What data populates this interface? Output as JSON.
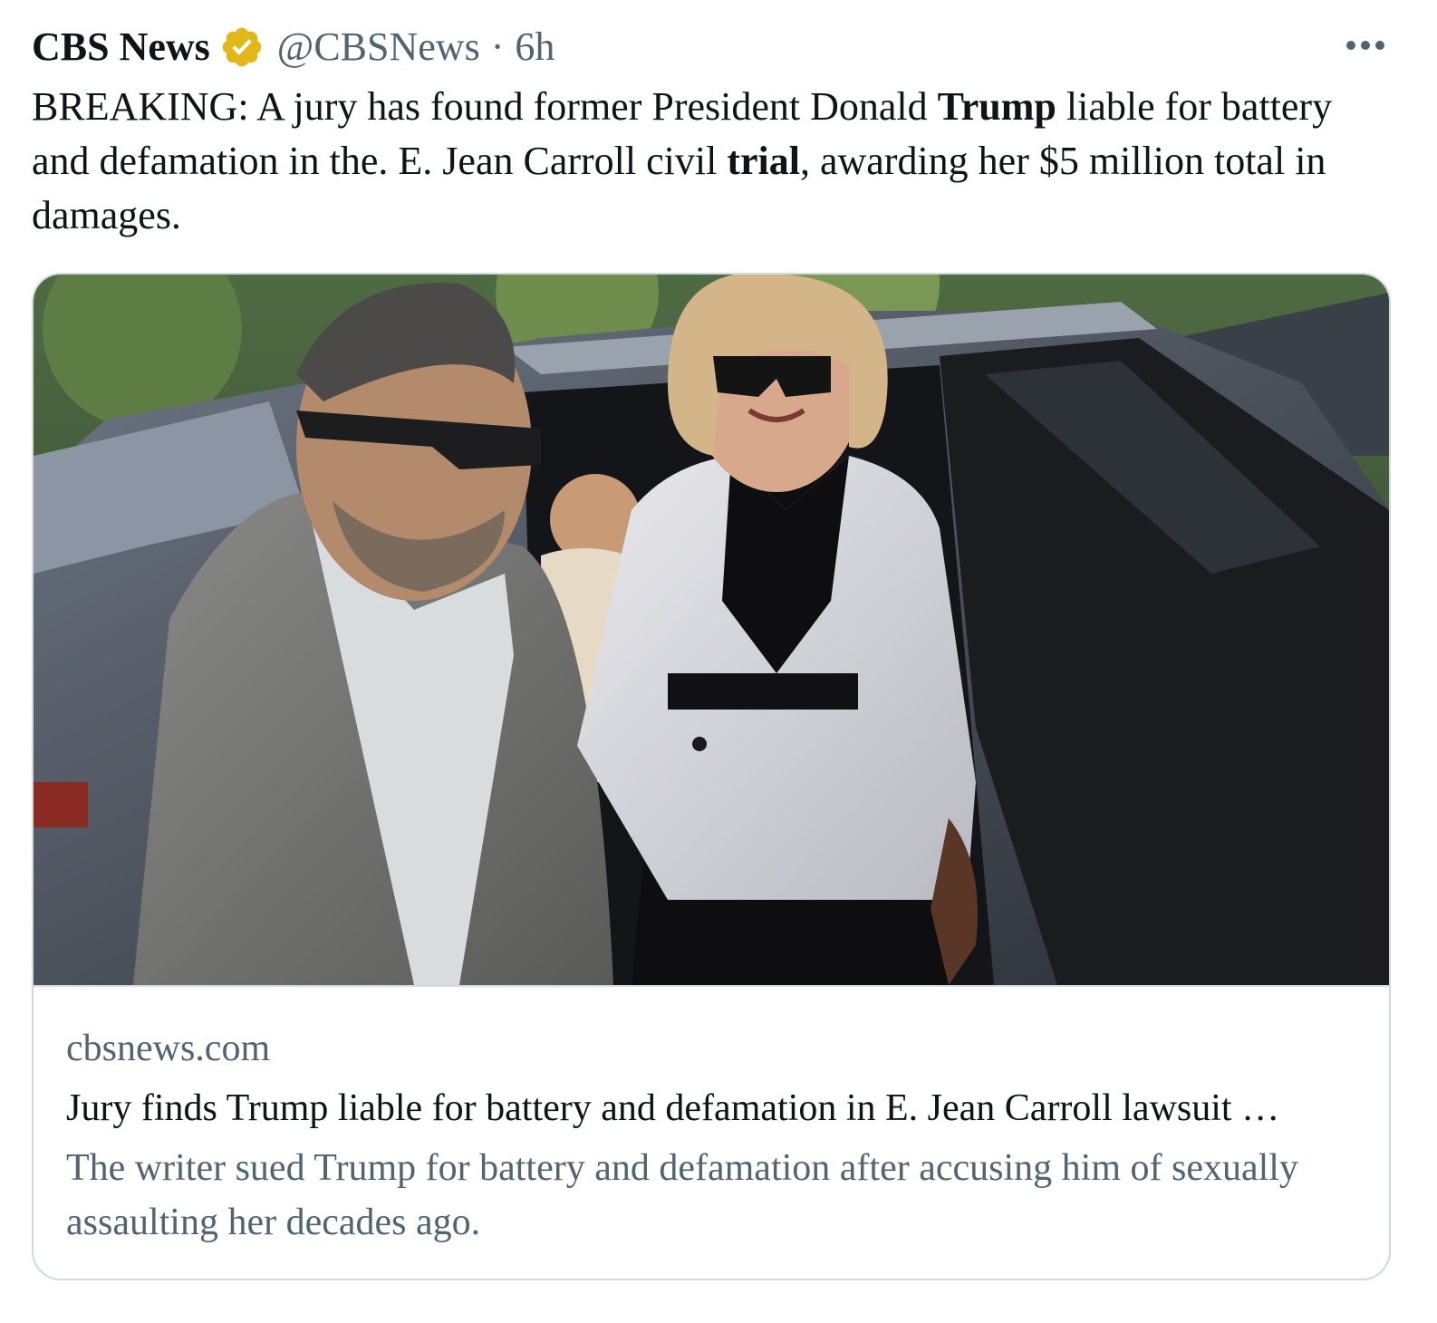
{
  "tweet": {
    "author": {
      "display_name": "CBS News",
      "verified_icon": "verified-gold-badge-icon",
      "handle": "@CBSNews",
      "separator": "·",
      "time": "6h"
    },
    "more_icon": "more-horizontal-icon",
    "text": {
      "part1": "BREAKING: A jury has found former President Donald ",
      "bold1": "Trump",
      "part2": " liable for battery and defamation in the. E. Jean Carroll civil ",
      "bold2": "trial",
      "part3": ", awarding her $5 million total in damages."
    },
    "card": {
      "image_icon": "news-photo",
      "domain": "cbsnews.com",
      "title": "Jury finds Trump liable for battery and defamation in E. Jean Carroll lawsuit …",
      "description": "The writer sued Trump for battery and defamation after accusing him of sexually assaulting her decades ago."
    }
  },
  "colors": {
    "text_primary": "#0f1419",
    "text_secondary": "#536471",
    "border": "#cfd9de",
    "verified_gold": "#e2b719"
  }
}
